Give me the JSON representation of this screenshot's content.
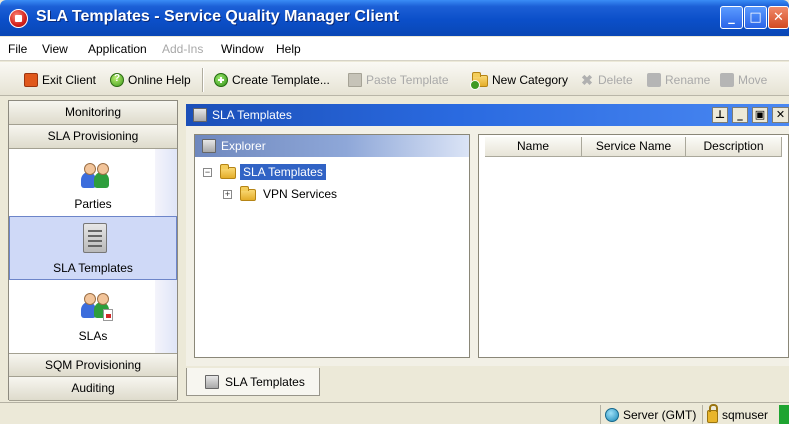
{
  "window": {
    "title": "SLA Templates - Service Quality Manager Client",
    "minimize_glyph": "_",
    "maximize_glyph": "□",
    "close_glyph": "✕"
  },
  "menubar": {
    "items": [
      {
        "label": "File",
        "enabled": true
      },
      {
        "label": "View",
        "enabled": true
      },
      {
        "label": "Application",
        "enabled": true
      },
      {
        "label": "Add-Ins",
        "enabled": false
      },
      {
        "label": "Window",
        "enabled": true
      },
      {
        "label": "Help",
        "enabled": true
      }
    ]
  },
  "toolbar": {
    "exit_label": "Exit Client",
    "help_label": "Online Help",
    "create_label": "Create Template...",
    "paste_label": "Paste Template",
    "new_category_label": "New Category",
    "delete_label": "Delete",
    "rename_label": "Rename",
    "move_label": "Move"
  },
  "leftnav": {
    "headers": [
      "Monitoring",
      "SLA Provisioning",
      "SQM Provisioning",
      "Auditing"
    ],
    "items": [
      {
        "label": "Parties",
        "icon": "parties-icon"
      },
      {
        "label": "SLA Templates",
        "icon": "sla-templates-icon",
        "selected": true
      },
      {
        "label": "SLAs",
        "icon": "slas-icon"
      }
    ]
  },
  "frame": {
    "title": "SLA Templates",
    "pin_glyph": "⊥",
    "min_glyph": "_",
    "restore_glyph": "▣",
    "close_glyph": "✕"
  },
  "explorer": {
    "title": "Explorer",
    "tree": [
      {
        "label": "SLA Templates",
        "expander": "−",
        "selected": true
      },
      {
        "label": "VPN Services",
        "expander": "+",
        "selected": false
      }
    ]
  },
  "table": {
    "columns": [
      "Name",
      "Service Name",
      "Description"
    ],
    "rows": []
  },
  "bottom_tab": {
    "label": "SLA Templates"
  },
  "status": {
    "server": "Server (GMT)",
    "user": "sqmuser",
    "indicator_color": "#1ea431"
  }
}
